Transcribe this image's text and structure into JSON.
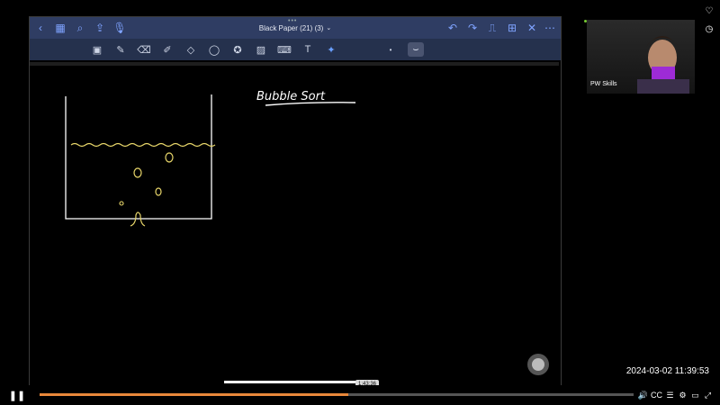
{
  "document": {
    "title": "Black Paper (21) (3)",
    "title_chevron": "⌄"
  },
  "titlebar_icons": [
    "back-icon",
    "grid-icon",
    "search-icon",
    "share-icon",
    "mic-icon",
    "undo-icon",
    "redo-icon",
    "bookmark-icon",
    "add-page-icon",
    "close-icon",
    "more-icon"
  ],
  "toolbar_icons": [
    "image-tool-icon",
    "pen-icon",
    "eraser-icon",
    "highlighter-icon",
    "shapes-icon",
    "lasso-icon",
    "star-icon",
    "photo-icon",
    "keyboard-icon",
    "text-icon",
    "laser-icon",
    "dot-size-icon",
    "stroke-icon"
  ],
  "canvas": {
    "heading": "Bubble Sort"
  },
  "webcam": {
    "label": "PW Skills"
  },
  "status": {
    "timestamp": "2024-03-02  11:39:53"
  },
  "player": {
    "progress": 0.52,
    "hover_time": "1:43:36",
    "colors": {
      "progress": "#e8873a",
      "track": "#555555"
    }
  }
}
